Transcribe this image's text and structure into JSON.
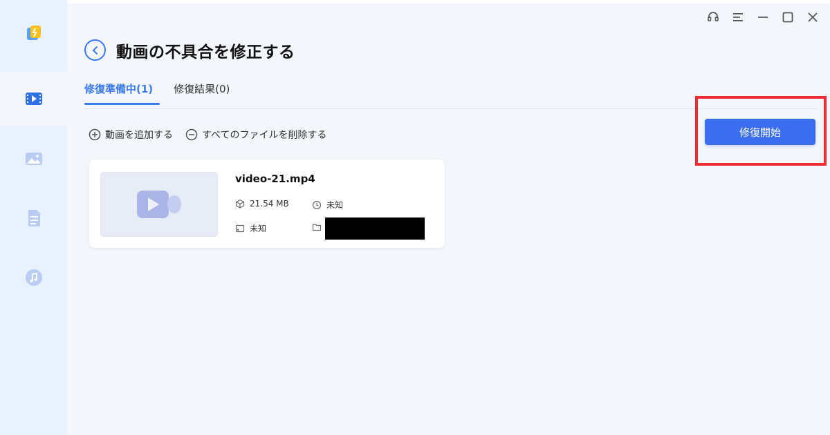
{
  "window": {
    "controls": [
      "headset-icon",
      "menu-icon",
      "minimize-icon",
      "maximize-icon",
      "close-icon"
    ]
  },
  "sidebar": {
    "items": [
      {
        "icon": "app-logo-icon"
      },
      {
        "icon": "video-icon",
        "active": true
      },
      {
        "icon": "image-icon"
      },
      {
        "icon": "document-icon"
      },
      {
        "icon": "music-icon"
      }
    ]
  },
  "header": {
    "title": "動画の不具合を修正する"
  },
  "tabs": [
    {
      "label": "修復準備中(1)",
      "active": true
    },
    {
      "label": "修復結果(0)",
      "active": false
    }
  ],
  "actions": {
    "add_label": "動画を追加する",
    "delete_all_label": "すべてのファイルを削除する"
  },
  "start_button": {
    "label": "修復開始"
  },
  "file": {
    "name": "video-21.mp4",
    "size": "21.54 MB",
    "duration": "未知",
    "resolution": "未知"
  },
  "colors": {
    "accent": "#3a7af2",
    "button": "#3a6df0",
    "highlight": "#ee2b33",
    "sidebar_bg": "#e9f1fd",
    "content_bg": "#f3f6fb"
  }
}
